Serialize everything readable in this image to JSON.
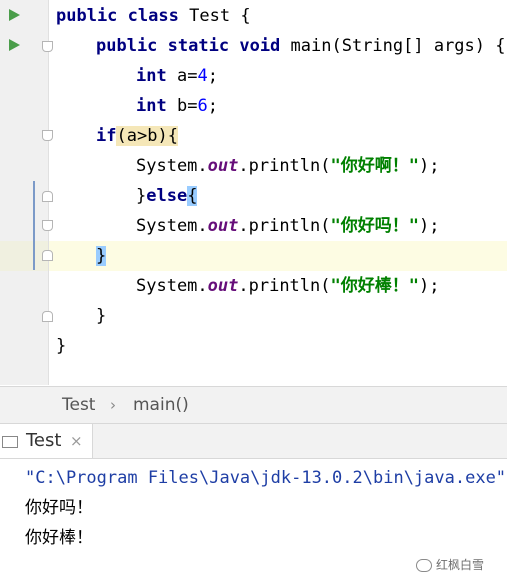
{
  "editor": {
    "code": {
      "l1": {
        "kw1": "public",
        "kw2": "class",
        "name": "Test",
        "brace": "{"
      },
      "l2": {
        "kw1": "public",
        "kw2": "static",
        "kw3": "void",
        "sig": "main(String[] args) {"
      },
      "l3": {
        "type": "int",
        "var": "a=",
        "val": "4",
        "end": ";"
      },
      "l4": {
        "type": "int",
        "var": "b=",
        "val": "6",
        "end": ";"
      },
      "l5": {
        "kw": "if",
        "open": "(",
        "cond": "a>b",
        "close": "){"
      },
      "l6": {
        "pre": "System.",
        "field": "out",
        "call": ".println(",
        "str": "\"你好啊！\"",
        "end": ");"
      },
      "l7": {
        "brace1": "}",
        "kw": "else",
        "brace2": "{"
      },
      "l8": {
        "pre": "System.",
        "field": "out",
        "call": ".println(",
        "str": "\"你好吗！\"",
        "end": ");"
      },
      "l9": {
        "brace": "}"
      },
      "l10": {
        "pre": "System.",
        "field": "out",
        "call": ".println(",
        "str": "\"你好棒！\"",
        "end": ");"
      },
      "l11": {
        "brace": "}"
      },
      "l12": {
        "brace": "}"
      }
    }
  },
  "breadcrumb": {
    "items": [
      "Test",
      "main()"
    ],
    "separator": "›"
  },
  "run_panel": {
    "tab_label": "Test",
    "close": "×"
  },
  "console": {
    "command": "\"C:\\Program Files\\Java\\jdk-13.0.2\\bin\\java.exe\"",
    "output": [
      "你好吗！",
      "你好棒！"
    ]
  },
  "watermark": {
    "text": "红枫白雪"
  },
  "colors": {
    "keyword": "#000080",
    "number": "#0000ff",
    "string": "#008000",
    "field": "#660e7a",
    "run": "#4a9d4a",
    "cmd": "#1e3ea5"
  }
}
